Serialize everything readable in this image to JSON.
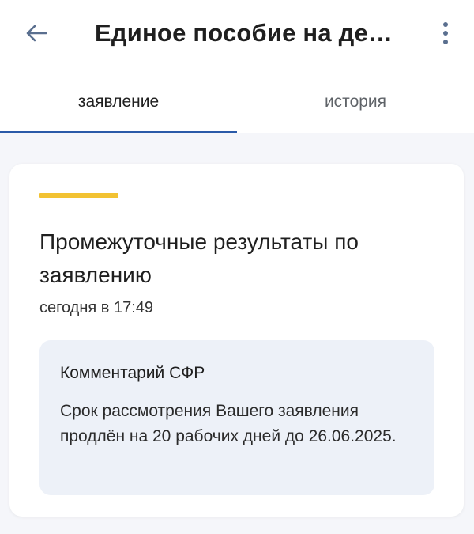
{
  "header": {
    "title": "Единое пособие на де…",
    "back_icon": "arrow-left-icon",
    "more_icon": "more-vertical-icon"
  },
  "tabs": [
    {
      "label": "заявление",
      "active": true
    },
    {
      "label": "история",
      "active": false
    }
  ],
  "card": {
    "title": "Промежуточные результаты по заявлению",
    "time": "сегодня в 17:49",
    "comment": {
      "title": "Комментарий СФР",
      "text": "Срок рассмотрения Вашего заявления продлён на 20 рабочих дней до 26.06.2025."
    }
  },
  "colors": {
    "accent": "#f2c232",
    "tab_indicator": "#2a5aa8",
    "comment_bg": "#edf1f8",
    "icon": "#5a6f8f"
  }
}
